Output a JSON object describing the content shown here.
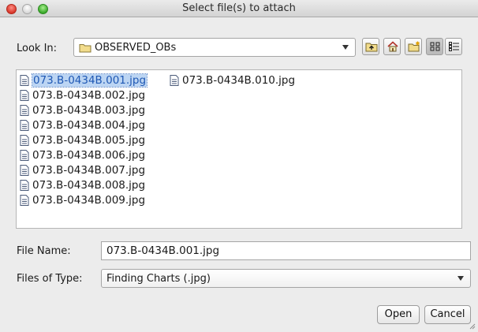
{
  "window": {
    "title": "Select file(s) to attach"
  },
  "look_in": {
    "label": "Look In:",
    "value": "OBSERVED_OBs"
  },
  "toolbar": {
    "icons": [
      "up-folder-icon",
      "home-icon",
      "new-folder-icon",
      "list-view-icon",
      "details-view-icon"
    ],
    "active_view": "list-view-icon"
  },
  "files": [
    {
      "name": "073.B-0434B.001.jpg",
      "selected": true
    },
    {
      "name": "073.B-0434B.002.jpg",
      "selected": false
    },
    {
      "name": "073.B-0434B.003.jpg",
      "selected": false
    },
    {
      "name": "073.B-0434B.004.jpg",
      "selected": false
    },
    {
      "name": "073.B-0434B.005.jpg",
      "selected": false
    },
    {
      "name": "073.B-0434B.006.jpg",
      "selected": false
    },
    {
      "name": "073.B-0434B.007.jpg",
      "selected": false
    },
    {
      "name": "073.B-0434B.008.jpg",
      "selected": false
    },
    {
      "name": "073.B-0434B.009.jpg",
      "selected": false
    },
    {
      "name": "073.B-0434B.010.jpg",
      "selected": false
    }
  ],
  "file_name": {
    "label": "File Name:",
    "value": "073.B-0434B.001.jpg"
  },
  "file_type": {
    "label": "Files of Type:",
    "value": "Finding Charts (.jpg)"
  },
  "buttons": {
    "open": "Open",
    "cancel": "Cancel"
  },
  "colors": {
    "selection_bg": "#bcd5f3",
    "selection_text": "#1f58b4"
  }
}
